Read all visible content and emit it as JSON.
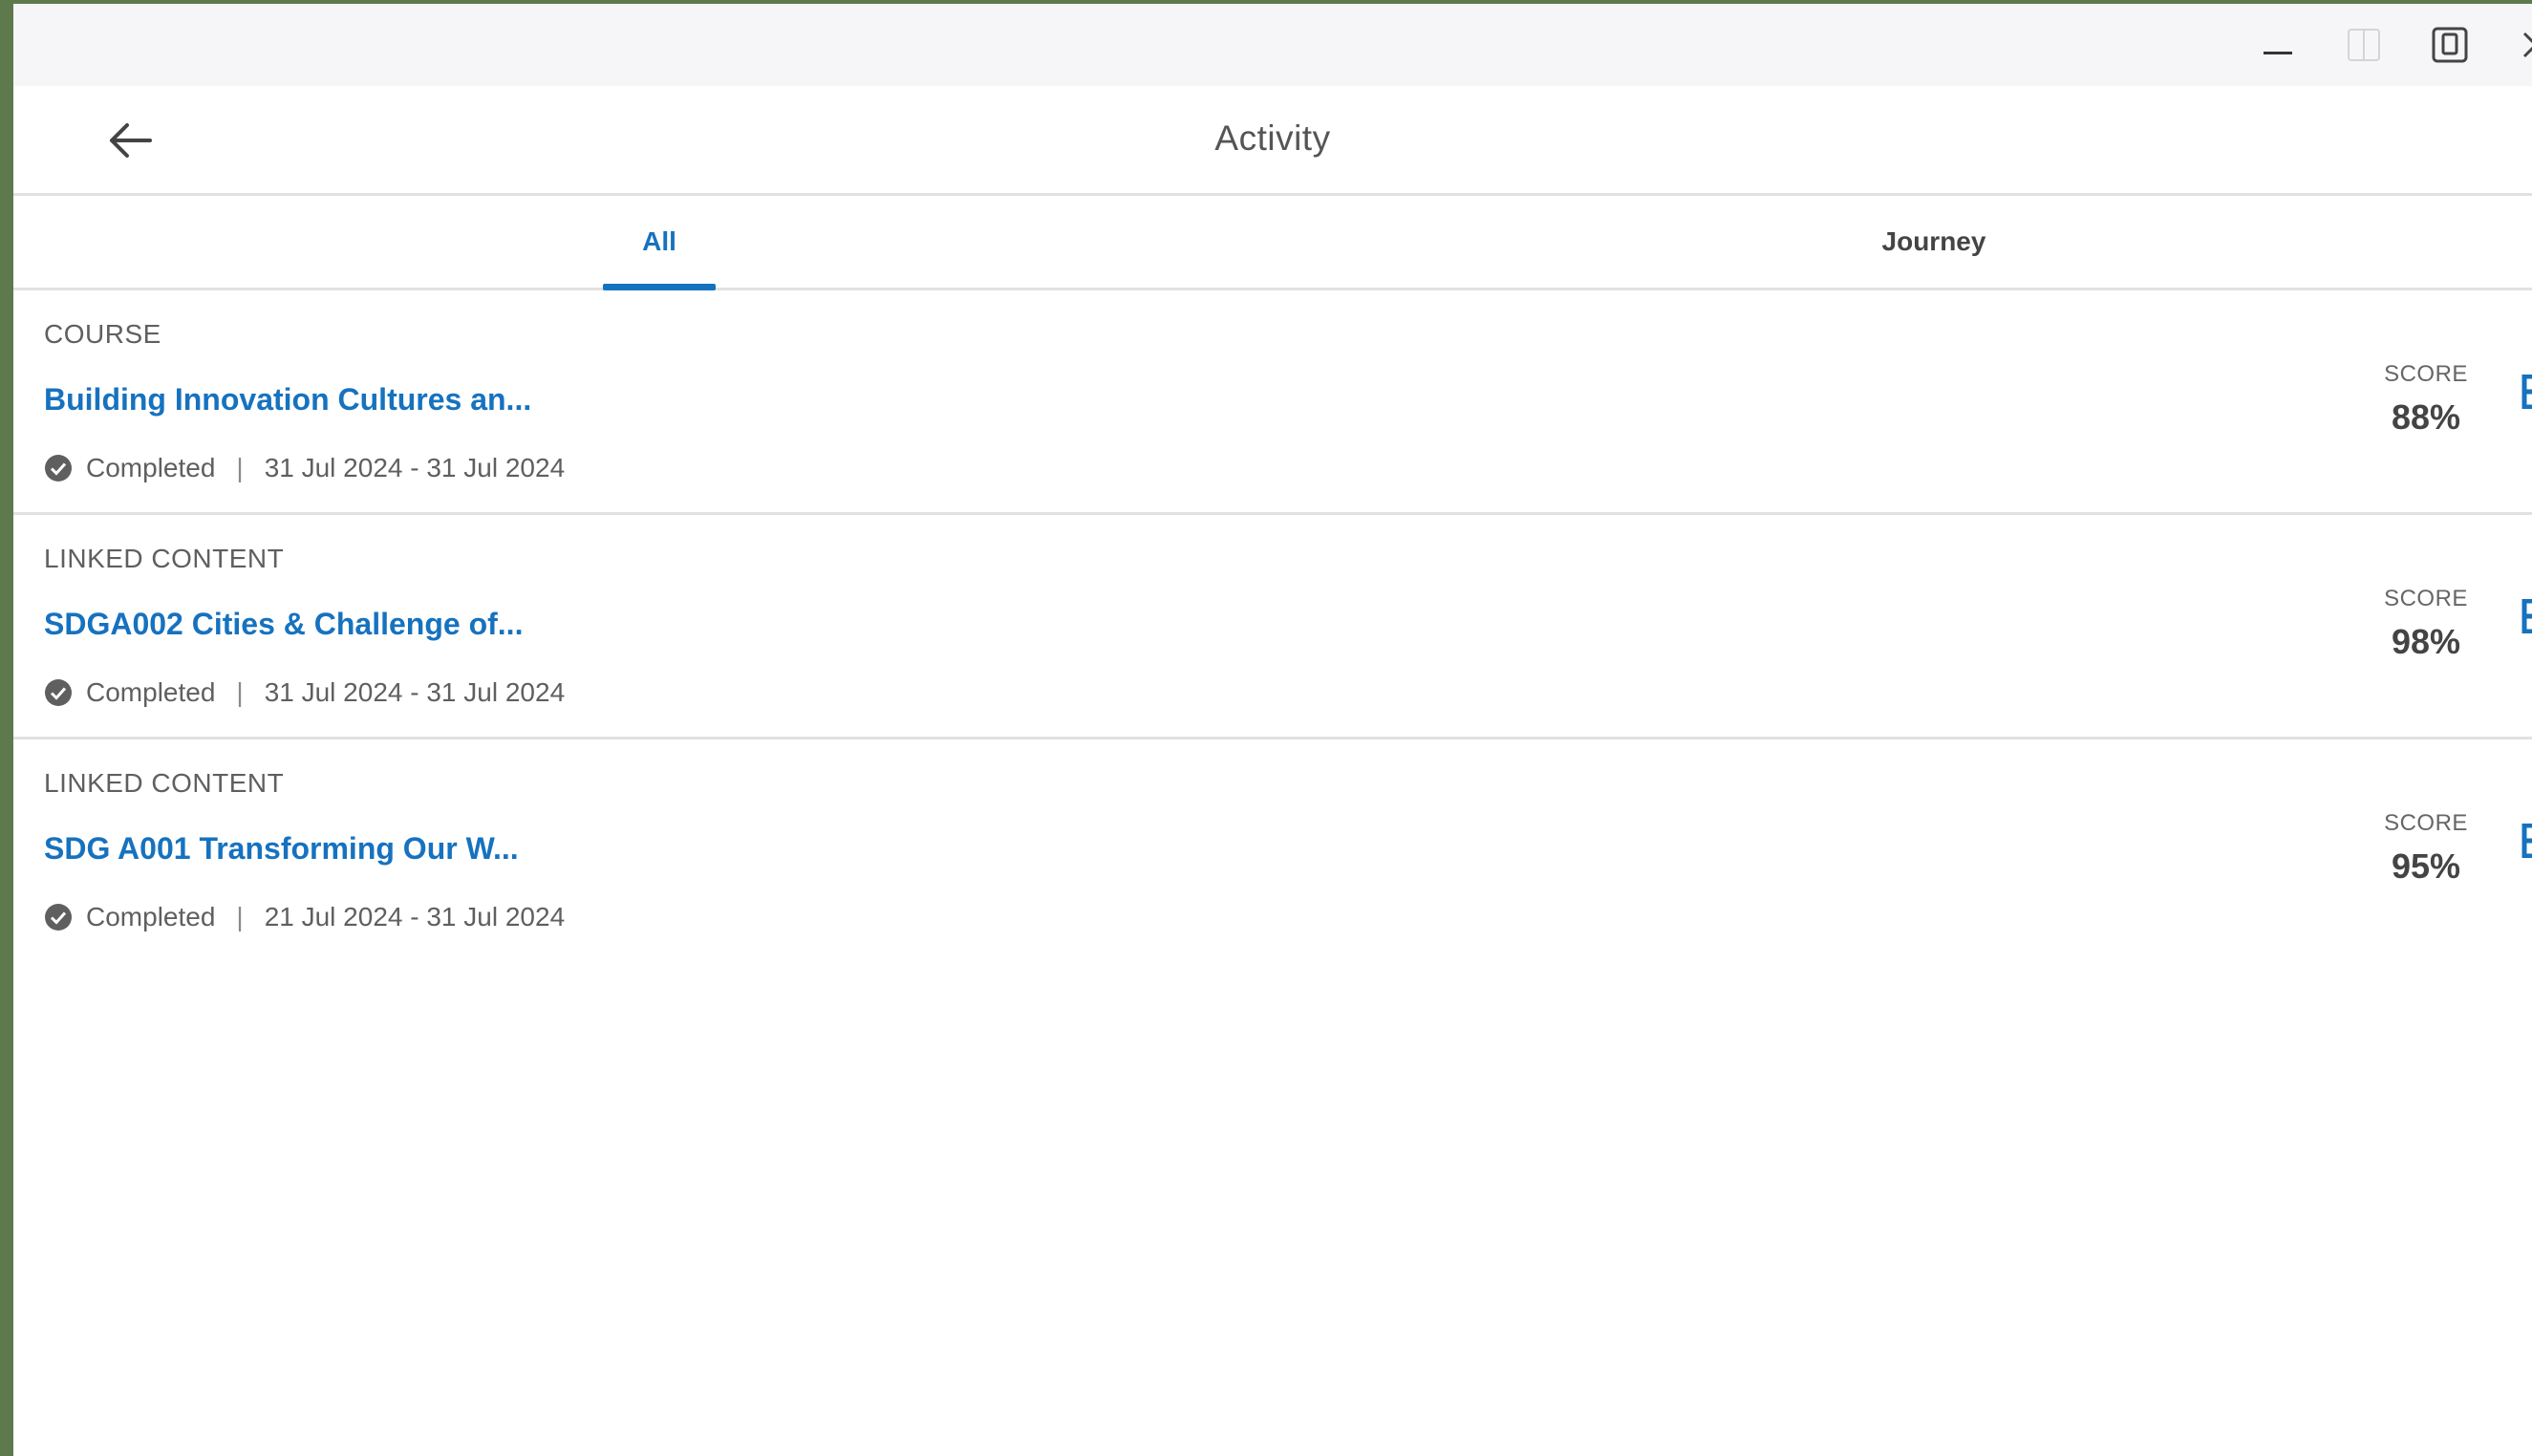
{
  "window_controls": {
    "minimize_icon": "minimize-icon",
    "snap_icon": "snap-layout-icon",
    "maximize_icon": "restore-icon",
    "close_icon": "close-icon"
  },
  "header": {
    "title": "Activity",
    "back_icon": "arrow-left-icon"
  },
  "tabs": [
    {
      "label": "All",
      "active": true
    },
    {
      "label": "Journey",
      "active": false
    }
  ],
  "items": [
    {
      "type": "COURSE",
      "title": "Building Innovation Cultures an...",
      "status": "Completed",
      "separator": "|",
      "dates": "31 Jul 2024 - 31 Jul 2024",
      "score_label": "SCORE",
      "score": "88%"
    },
    {
      "type": "LINKED CONTENT",
      "title": "SDGA002 Cities & Challenge of...",
      "status": "Completed",
      "separator": "|",
      "dates": "31 Jul 2024 - 31 Jul 2024",
      "score_label": "SCORE",
      "score": "98%"
    },
    {
      "type": "LINKED CONTENT",
      "title": "SDG A001 Transforming Our W...",
      "status": "Completed",
      "separator": "|",
      "dates": "21 Jul 2024 - 31 Jul 2024",
      "score_label": "SCORE",
      "score": "95%"
    }
  ],
  "colors": {
    "accent": "#1672bf",
    "text_secondary": "#5f5f5f",
    "divider": "#e1e1e1",
    "titlebar": "#f6f6f9"
  }
}
